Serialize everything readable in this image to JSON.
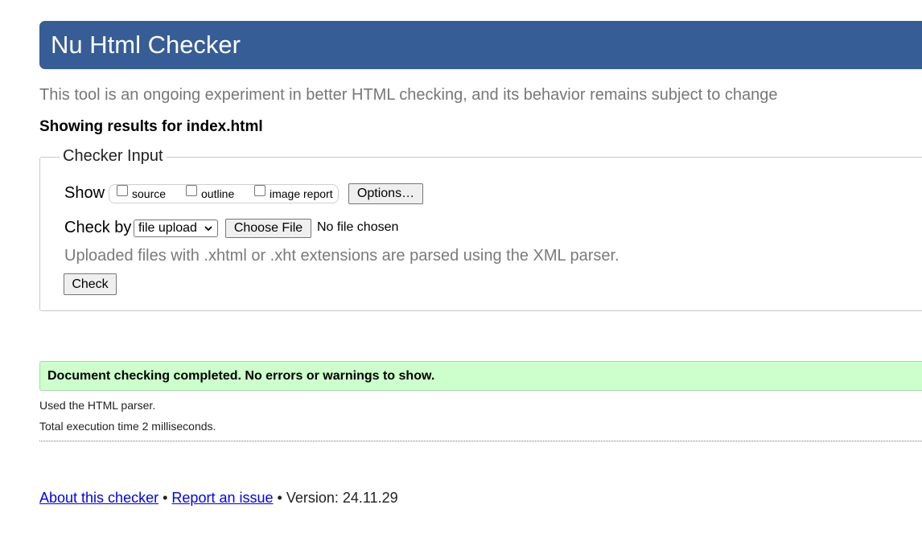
{
  "header": {
    "title": "Nu Html Checker"
  },
  "tagline": "This tool is an ongoing experiment in better HTML checking, and its behavior remains subject to change",
  "showing_results": "Showing results for index.html",
  "checker_input": {
    "legend": "Checker Input",
    "show_label": "Show",
    "show_options": [
      {
        "label": "source",
        "checked": false
      },
      {
        "label": "outline",
        "checked": false
      },
      {
        "label": "image report",
        "checked": false
      }
    ],
    "options_button": "Options…",
    "check_by_label": "Check by",
    "check_by_selected": "file upload",
    "choose_file_button": "Choose File",
    "no_file_text": "No file chosen",
    "hint": "Uploaded files with .xhtml or .xht extensions are parsed using the XML parser.",
    "check_button": "Check"
  },
  "results": {
    "success_message": "Document checking completed. No errors or warnings to show.",
    "parser_info": "Used the HTML parser.",
    "execution_time": "Total execution time 2 milliseconds."
  },
  "footer": {
    "about_link": "About this checker",
    "separator": "•",
    "report_link": "Report an issue",
    "version": "Version: 24.11.29"
  },
  "colors": {
    "header_bg": "#365d95",
    "success_bg": "#ccffcc",
    "link": "#0000ee"
  }
}
